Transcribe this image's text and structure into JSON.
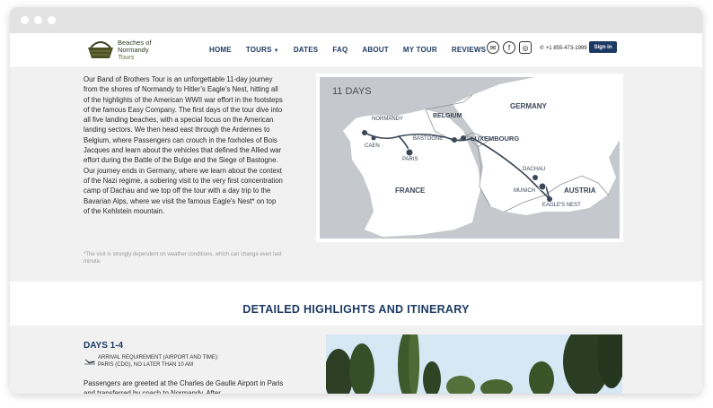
{
  "header": {
    "logo_line1": "Beaches of",
    "logo_line2": "Normandy",
    "logo_line3": "Tours",
    "nav": [
      {
        "label": "HOME"
      },
      {
        "label": "TOURS",
        "has_dropdown": true
      },
      {
        "label": "DATES"
      },
      {
        "label": "FAQ"
      },
      {
        "label": "ABOUT"
      },
      {
        "label": "MY TOUR"
      },
      {
        "label": "REVIEWS"
      }
    ],
    "social_icons": [
      "mail-icon",
      "facebook-icon",
      "instagram-icon"
    ],
    "phone": "+1 855-473-1999",
    "signin_label": "Sign in"
  },
  "intro": {
    "text": "Our Band of Brothers Tour is an unforgettable 11-day journey from the shores of Normandy to Hitler’s Eagle’s Nest, hitting all of the highlights of the American WWII war effort in the footsteps of the famous Easy Company. The first days of the tour dive into all five landing beaches, with a special focus on the American landing sectors. We then head east through the Ardennes to Belgium, where Passengers can crouch in the foxholes of Bois Jacques and learn about the vehicles that defined the Allied war effort during the Battle of the Bulge and the Siege of Bastogne. Our journey ends in Germany, where we learn about the context of the Nazi regime, a sobering visit to the very first concentration camp of Dachau and we top off the tour with a day trip to the Bavarian Alps, where we visit the famous Eagle's Nest* on top of the Kehlstein mountain.",
    "note": "*The visit is strongly dependent on weather conditions, which can change even last minute."
  },
  "map": {
    "days_label": "11 DAYS",
    "countries": [
      "GERMANY",
      "BELGIUM",
      "LUXEMBOURG",
      "FRANCE",
      "AUSTRIA"
    ],
    "places": [
      "NORMANDY",
      "CAEN",
      "PARIS",
      "BASTOGNE",
      "DACHAU",
      "MUNICH",
      "EAGLE'S NEST"
    ]
  },
  "highlights": {
    "title": "DETAILED HIGHLIGHTS AND ITINERARY"
  },
  "day": {
    "title": "DAYS 1-4",
    "arrival_line1": "ARRIVAL REQUIREMENT (AIRPORT AND TIME):",
    "arrival_line2": "PARIS (CDG), NO LATER THAN 10 AM",
    "text": "Passengers are greeted at the Charles de Gaulle Airport in Paris and transferred by coach to Normandy. After..."
  },
  "colors": {
    "navy": "#1d3a63",
    "map_water": "#c5c8cc",
    "map_land": "#ffffff"
  }
}
